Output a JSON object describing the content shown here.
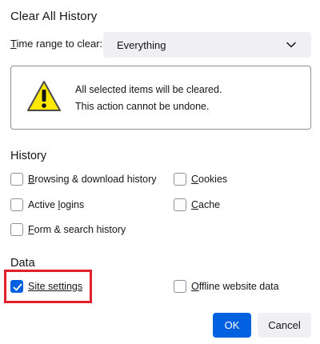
{
  "dialog": {
    "title": "Clear All History",
    "range_label_prefix": "T",
    "range_label_rest": "ime range to clear:",
    "range_value": "Everything"
  },
  "warning": {
    "icon": "warning-icon",
    "line1": "All selected items will be cleared.",
    "line2": "This action cannot be undone."
  },
  "history": {
    "title": "History",
    "items": [
      {
        "accesskey": "B",
        "rest": "rowsing & download history",
        "checked": false
      },
      {
        "accesskey": "C",
        "rest": "ookies",
        "checked": false
      },
      {
        "accesskey": "A",
        "rest": "ctive ",
        "accesskey2": "l",
        "rest2": "ogins",
        "checked": false
      },
      {
        "accesskey": "C",
        "rest": "ache",
        "checked": false
      },
      {
        "accesskey": "F",
        "rest": "orm & search history",
        "checked": false
      }
    ]
  },
  "data_section": {
    "title": "Data",
    "items": [
      {
        "accesskey": "S",
        "rest": "ite settings",
        "checked": true
      },
      {
        "accesskey": "O",
        "rest": "ffline website data",
        "checked": false
      }
    ]
  },
  "buttons": {
    "ok": "OK",
    "cancel": "Cancel"
  },
  "colors": {
    "accent": "#0061e0",
    "highlight": "#e0202a",
    "warning": "#ffe900"
  }
}
